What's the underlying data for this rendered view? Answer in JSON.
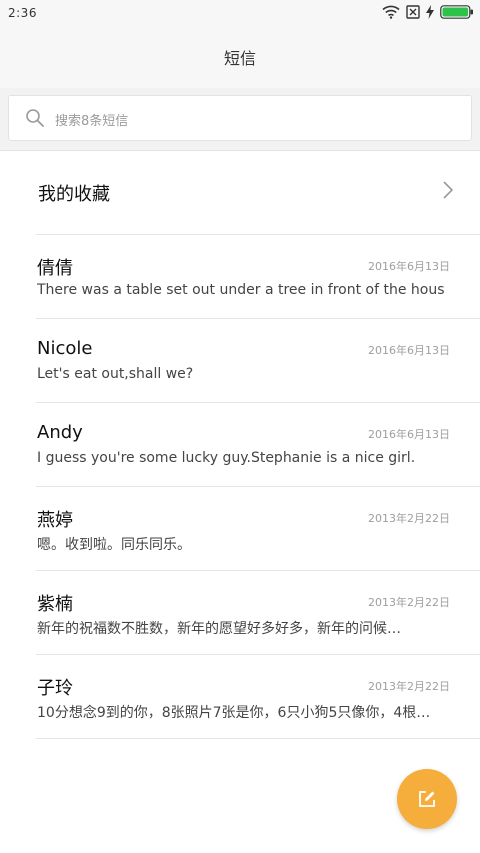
{
  "status_bar": {
    "time": "2:36"
  },
  "header": {
    "title": "短信"
  },
  "search": {
    "placeholder": "搜索8条短信"
  },
  "favorites": {
    "label": "我的收藏"
  },
  "conversations": [
    {
      "name": "倩倩",
      "date": "2016年6月13日",
      "message": "There was a table set out under a tree in front of the hous"
    },
    {
      "name": "Nicole",
      "date": "2016年6月13日",
      "message": "Let's eat out,shall we?"
    },
    {
      "name": "Andy",
      "date": "2016年6月13日",
      "message": "I guess you're some lucky guy.Stephanie is a nice girl."
    },
    {
      "name": "燕婷",
      "date": "2013年2月22日",
      "message": "嗯。收到啦。同乐同乐。"
    },
    {
      "name": "紫楠",
      "date": "2013年2月22日",
      "message": "新年的祝福数不胜数，新年的愿望好多好多，新年的问候…"
    },
    {
      "name": "子玲",
      "date": "2013年2月22日",
      "message": "10分想念9到的你，8张照片7张是你，6只小狗5只像你，4根…"
    }
  ],
  "colors": {
    "fab": "#f5ad3b",
    "battery": "#2fc24a"
  }
}
